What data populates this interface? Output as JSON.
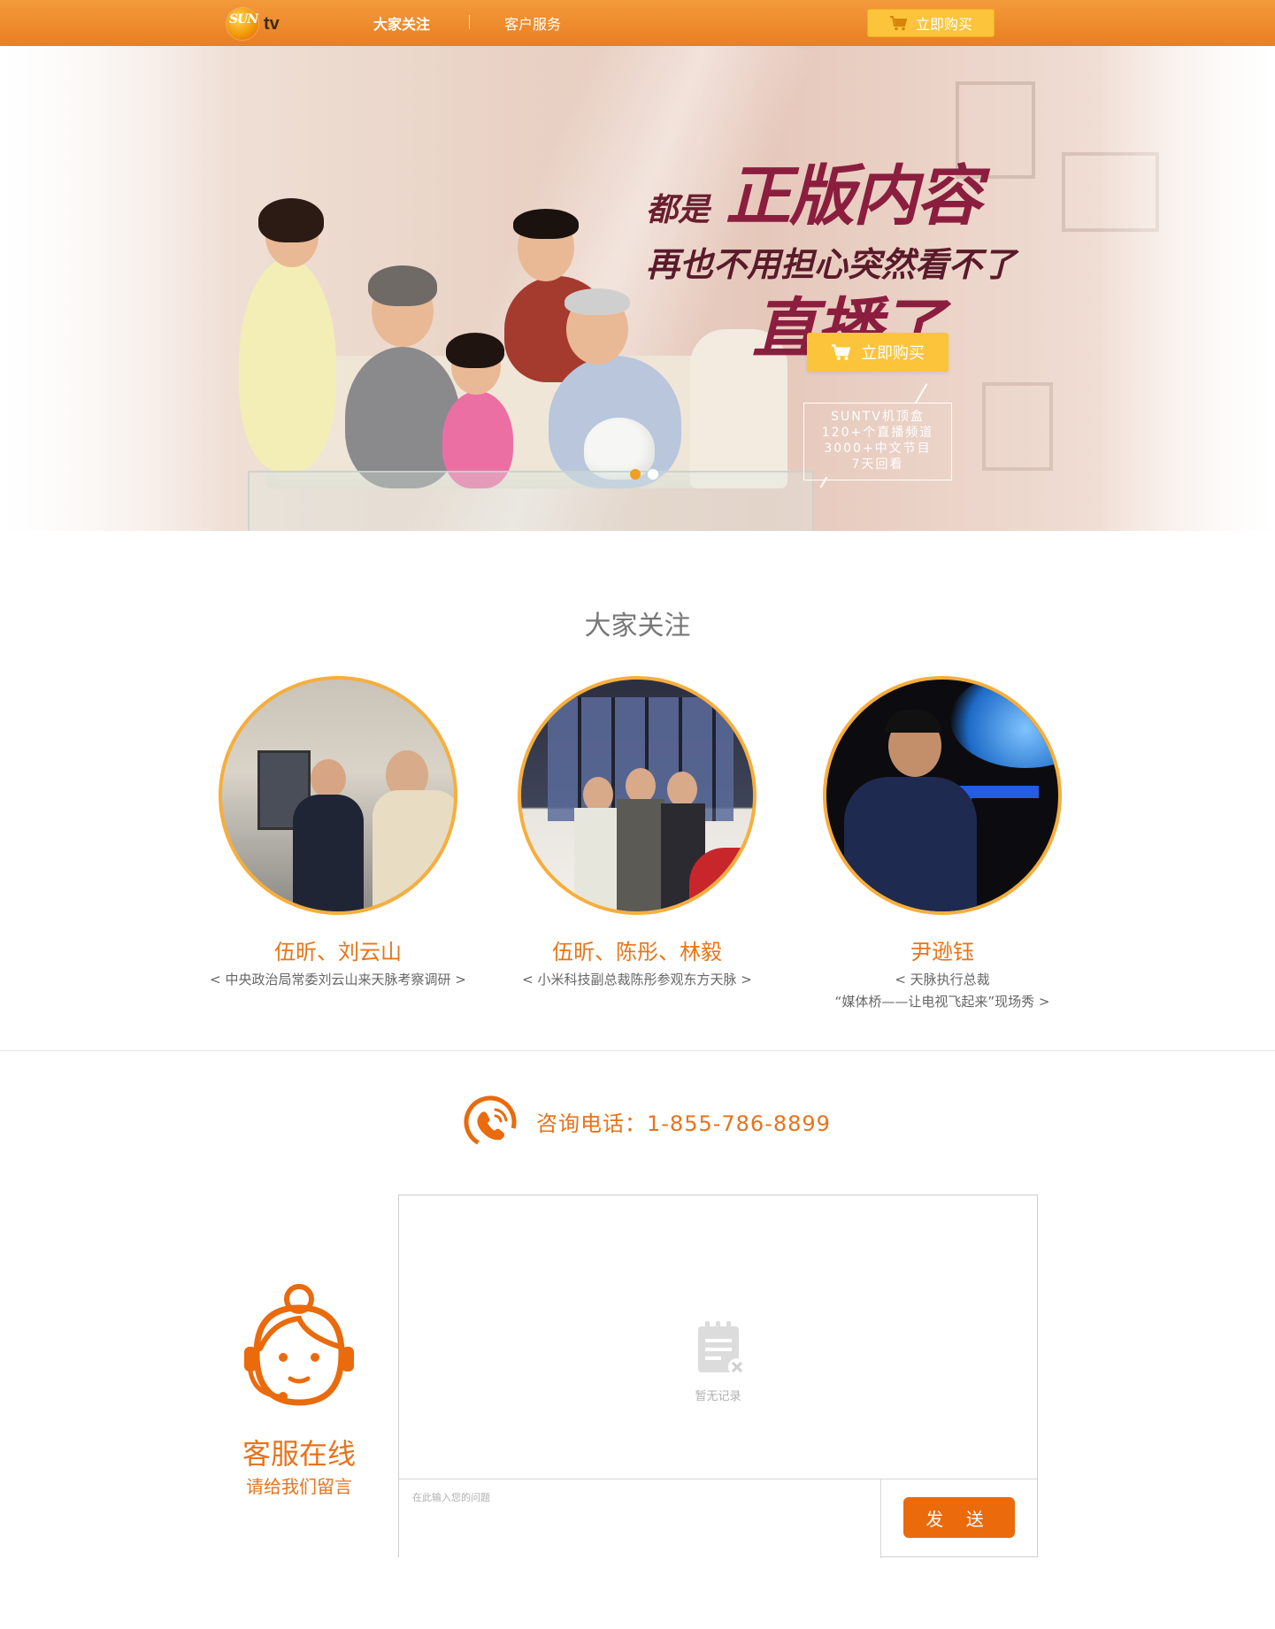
{
  "nav": {
    "logo_sun": "SUN",
    "logo_tv": "tv",
    "items": [
      {
        "label": "大家关注",
        "active": true
      },
      {
        "label": "客户服务",
        "active": false
      }
    ],
    "buy_label": "立即购买"
  },
  "hero": {
    "line1": "都是",
    "line2": "正版内容",
    "line3": "再也不用担心突然看不了",
    "line4": "直播了",
    "buy_label": "立即购买",
    "info": [
      "SUNTV机顶盒",
      "120+个直播频道",
      "3000+中文节目",
      "7天回看"
    ]
  },
  "attention": {
    "title": "大家关注",
    "cards": [
      {
        "name": "伍昕、刘云山",
        "desc": [
          "< 中央政治局常委刘云山来天脉考察调研 >"
        ]
      },
      {
        "name": "伍昕、陈彤、林毅",
        "desc": [
          "< 小米科技副总裁陈彤参观东方天脉 >"
        ]
      },
      {
        "name": "尹逊钰",
        "desc": [
          "< 天脉执行总裁",
          "“媒体桥——让电视飞起来”现场秀 >"
        ]
      }
    ]
  },
  "contact": {
    "phone_text": "咨询电话：1-855-786-8899",
    "agent_title": "客服在线",
    "agent_sub": "请给我们留言",
    "chat_empty": "暂无记录",
    "input_placeholder": "在此输入您的问题",
    "send_label": "发 送"
  },
  "colors": {
    "brand_orange": "#ea7f22",
    "accent_yellow": "#fbc43a",
    "text_orange": "#e8731a",
    "headline_red": "#8b1e3f"
  }
}
